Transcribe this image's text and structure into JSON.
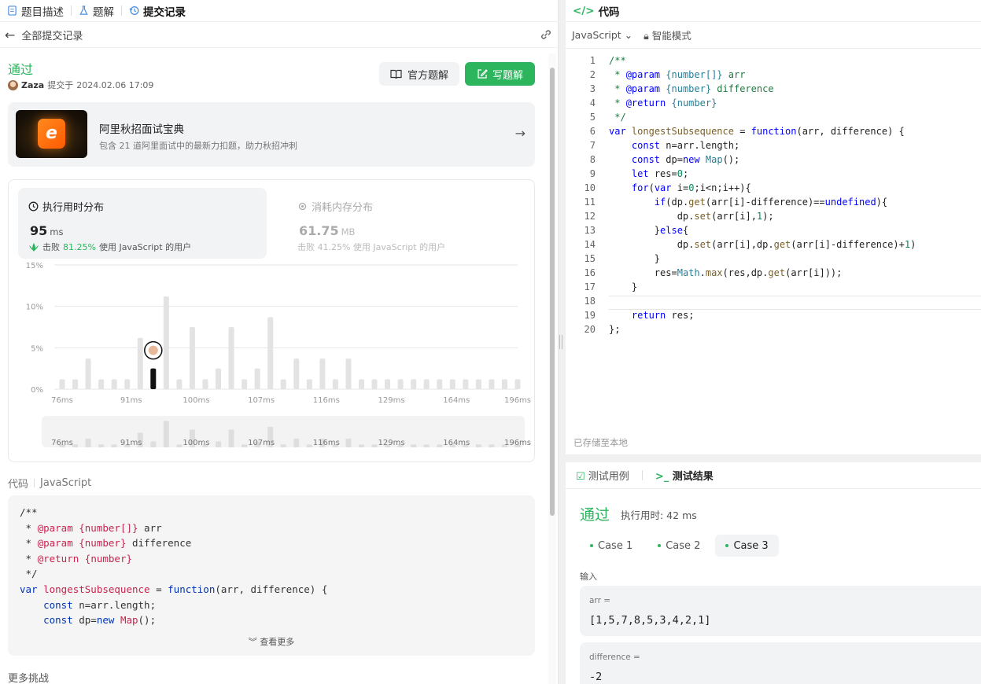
{
  "left_tabs": [
    {
      "label": "题目描述",
      "icon": "description-icon"
    },
    {
      "label": "题解",
      "icon": "flask-icon"
    },
    {
      "label": "提交记录",
      "icon": "history-icon"
    }
  ],
  "back": {
    "label": "全部提交记录"
  },
  "submission": {
    "status": "通过",
    "user": "Zaza",
    "submitted_prefix": "提交于",
    "time": "2024.02.06 17:09",
    "official_solution": "官方题解",
    "write_solution": "写题解"
  },
  "promo": {
    "title": "阿里秋招面试宝典",
    "subtitle": "包含 21 道阿里面试中的最新力扣题，助力秋招冲刺",
    "logo_text": "e"
  },
  "runtime": {
    "title": "执行用时分布",
    "value": "95",
    "unit": "ms",
    "beat_label": "击败",
    "beat_pct": "81.25%",
    "beat_suffix": "使用 JavaScript 的用户"
  },
  "memory": {
    "title": "消耗内存分布",
    "value": "61.75",
    "unit": "MB",
    "beat_text": "击败 41.25% 使用 JavaScript 的用户"
  },
  "chart_data": {
    "type": "bar",
    "title": "",
    "xlabel": "",
    "ylabel": "",
    "ylim": [
      0,
      15
    ],
    "yticks": [
      "15%",
      "10%",
      "5%",
      "0%"
    ],
    "xtick_labels": [
      "76ms",
      "91ms",
      "100ms",
      "107ms",
      "116ms",
      "129ms",
      "164ms",
      "196ms"
    ],
    "values": [
      1.2,
      1.2,
      3.7,
      1.2,
      1.2,
      1.2,
      6.2,
      2.5,
      11.2,
      1.2,
      7.5,
      1.2,
      2.5,
      7.5,
      1.2,
      2.5,
      8.7,
      1.2,
      3.7,
      1.2,
      3.7,
      1.2,
      3.7,
      1.2,
      1.2,
      1.2,
      1.2,
      1.2,
      1.2,
      1.2,
      1.2,
      1.2,
      1.2,
      1.2,
      1.2,
      1.2
    ],
    "highlight_index": 7,
    "highlight_color": "#111111",
    "bar_color": "#e3e3e3"
  },
  "minimap": {
    "labels": [
      "76ms",
      "91ms",
      "100ms",
      "107ms",
      "116ms",
      "129ms",
      "164ms",
      "196ms"
    ]
  },
  "code_section": {
    "label": "代码",
    "lang": "JavaScript",
    "see_more": "查看更多"
  },
  "preview_code": [
    [
      [
        "/**",
        "#333"
      ]
    ],
    [
      [
        " * ",
        "#333"
      ],
      [
        "@param",
        "#c7254e"
      ],
      [
        " {number[]}",
        "#c7254e"
      ],
      [
        " arr",
        "#333"
      ]
    ],
    [
      [
        " * ",
        "#333"
      ],
      [
        "@param",
        "#c7254e"
      ],
      [
        " {number}",
        "#c7254e"
      ],
      [
        " difference",
        "#333"
      ]
    ],
    [
      [
        " * ",
        "#333"
      ],
      [
        "@return",
        "#c7254e"
      ],
      [
        " {number}",
        "#c7254e"
      ]
    ],
    [
      [
        " */",
        "#333"
      ]
    ],
    [
      [
        "var",
        "#0033b3"
      ],
      [
        " longestSubsequence ",
        "#c7254e"
      ],
      [
        "=",
        "#333"
      ],
      [
        " function",
        "#0033b3"
      ],
      [
        "(arr, difference) {",
        "#333"
      ]
    ],
    [
      [
        "    const",
        "#0033b3"
      ],
      [
        " n=arr.length;",
        "#333"
      ]
    ],
    [
      [
        "    const",
        "#0033b3"
      ],
      [
        " dp=",
        "#333"
      ],
      [
        "new",
        "#0033b3"
      ],
      [
        " Map",
        "#c7254e"
      ],
      [
        "();",
        "#333"
      ]
    ]
  ],
  "more_challenges": "更多挑战",
  "editor": {
    "title": "代码",
    "lang": "JavaScript",
    "mode": "智能模式",
    "saved": "已存储至本地",
    "lines": [
      "/**",
      " * @param {number[]} arr",
      " * @param {number} difference",
      " * @return {number}",
      " */",
      "var longestSubsequence = function(arr, difference) {",
      "    const n=arr.length;",
      "    const dp=new Map();",
      "    let res=0;",
      "    for(var i=0;i<n;i++){",
      "        if(dp.get(arr[i]-difference)==undefined){",
      "            dp.set(arr[i],1);",
      "        }else{",
      "            dp.set(arr[i],dp.get(arr[i]-difference)+1)",
      "        }",
      "        res=Math.max(res,dp.get(arr[i]));",
      "    }",
      "",
      "    return res;",
      "};"
    ]
  },
  "testcase_tabs": {
    "cases_label": "测试用例",
    "result_label": "测试结果"
  },
  "result": {
    "status": "通过",
    "time": "执行用时: 42 ms",
    "cases": [
      "Case 1",
      "Case 2",
      "Case 3"
    ],
    "selected": 2,
    "input_label": "输入",
    "inputs": [
      {
        "name": "arr =",
        "value": "[1,5,7,8,5,3,4,2,1]"
      },
      {
        "name": "difference =",
        "value": "-2"
      }
    ]
  }
}
